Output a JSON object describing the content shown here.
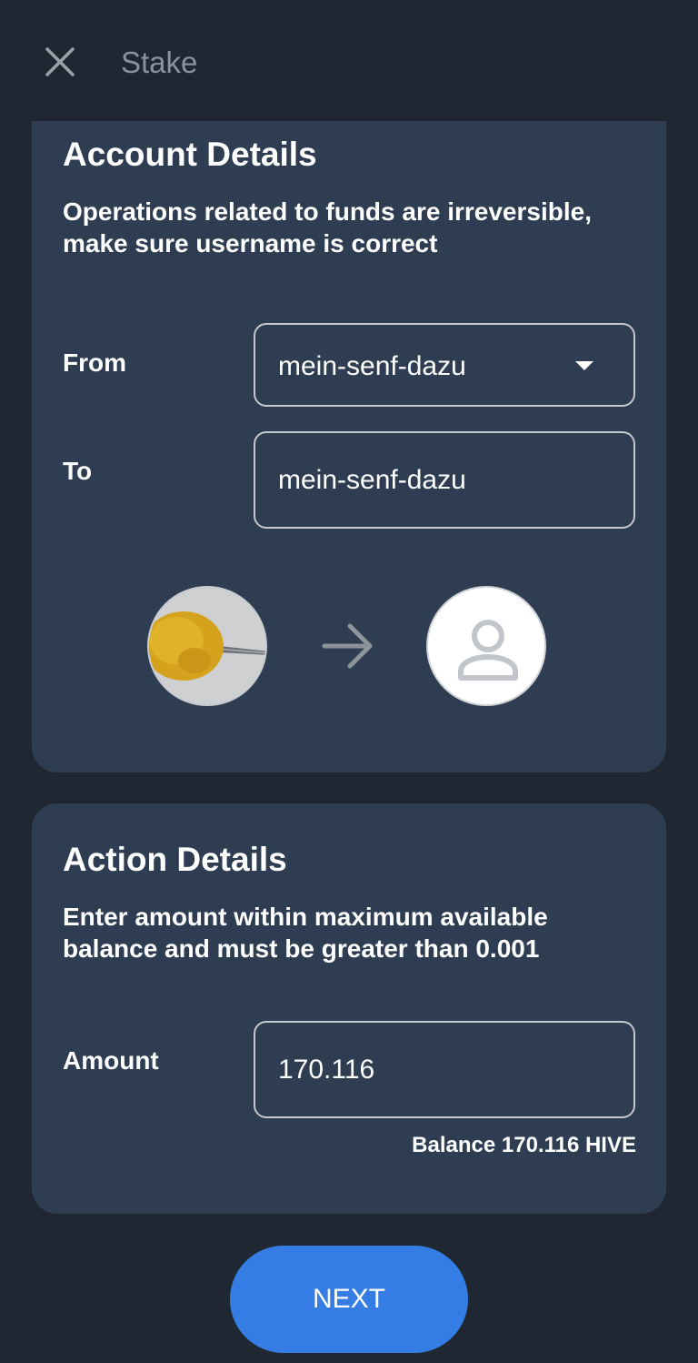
{
  "header": {
    "title": "Stake",
    "close_icon": "close-icon"
  },
  "account_details": {
    "title": "Account Details",
    "description": "Operations related to funds are irreversible, make sure username is correct",
    "from_label": "From",
    "from_value": "mein-senf-dazu",
    "to_label": "To",
    "to_value": "mein-senf-dazu",
    "transfer_icon": "arrow-right-icon",
    "recipient_icon": "user-placeholder-icon"
  },
  "action_details": {
    "title": "Action Details",
    "description": "Enter amount within maximum available balance  and must be greater than 0.001",
    "amount_label": "Amount",
    "amount_value": "170.116",
    "balance_text": "Balance 170.116 HIVE"
  },
  "footer": {
    "next_label": "NEXT"
  },
  "colors": {
    "background": "#1f2733",
    "card": "#2f3d52",
    "accent": "#357ce5",
    "muted": "#8a929b"
  }
}
